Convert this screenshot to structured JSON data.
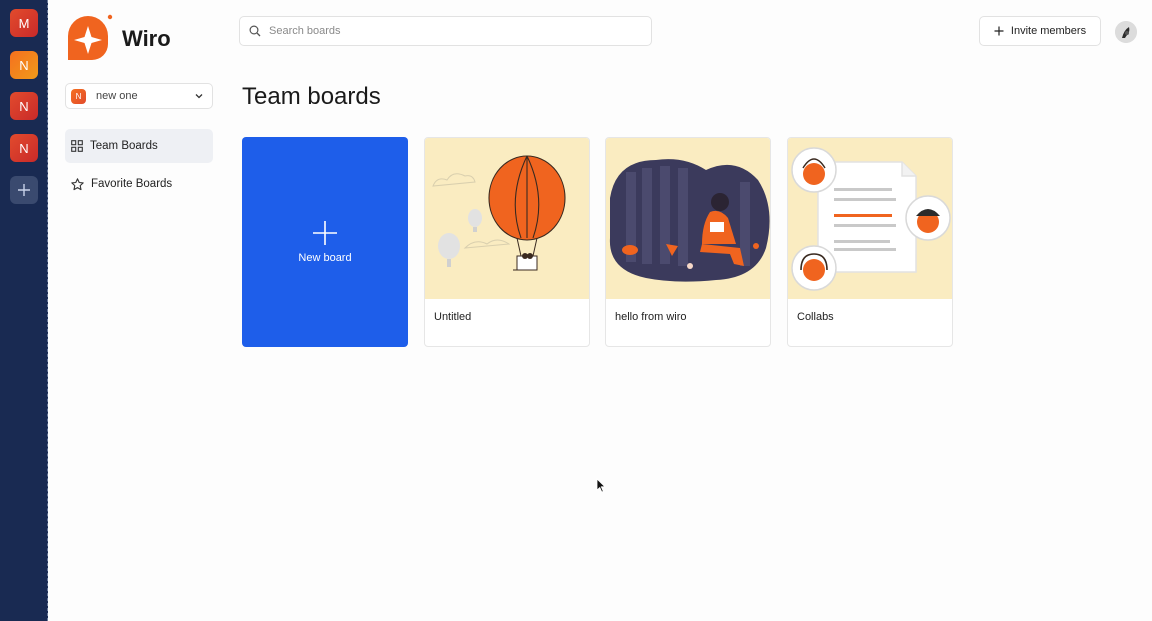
{
  "orgs": [
    {
      "letter": "M",
      "color": "red"
    },
    {
      "letter": "N",
      "color": "orange"
    },
    {
      "letter": "N",
      "color": "red"
    },
    {
      "letter": "N",
      "color": "red"
    }
  ],
  "org_add_icon": "plus-icon",
  "logo": {
    "text": "Wiro",
    "color": "#f0641f"
  },
  "team_select": {
    "avatar_letter": "N",
    "value": "new one"
  },
  "nav": {
    "team_boards": "Team Boards",
    "favorite_boards": "Favorite Boards"
  },
  "search": {
    "placeholder": "Search boards"
  },
  "invite": {
    "label": "Invite members"
  },
  "page": {
    "title": "Team boards"
  },
  "new_board": {
    "label": "New board"
  },
  "boards": [
    {
      "name": "Untitled",
      "illustration": "hot-air-balloon"
    },
    {
      "name": "hello from wiro",
      "illustration": "person-reading"
    },
    {
      "name": "Collabs",
      "illustration": "document-collaborators"
    }
  ],
  "colors": {
    "accent": "#1e5eea",
    "brand": "#f0641f",
    "rail": "#192a52",
    "thumb": "#faecc1"
  }
}
